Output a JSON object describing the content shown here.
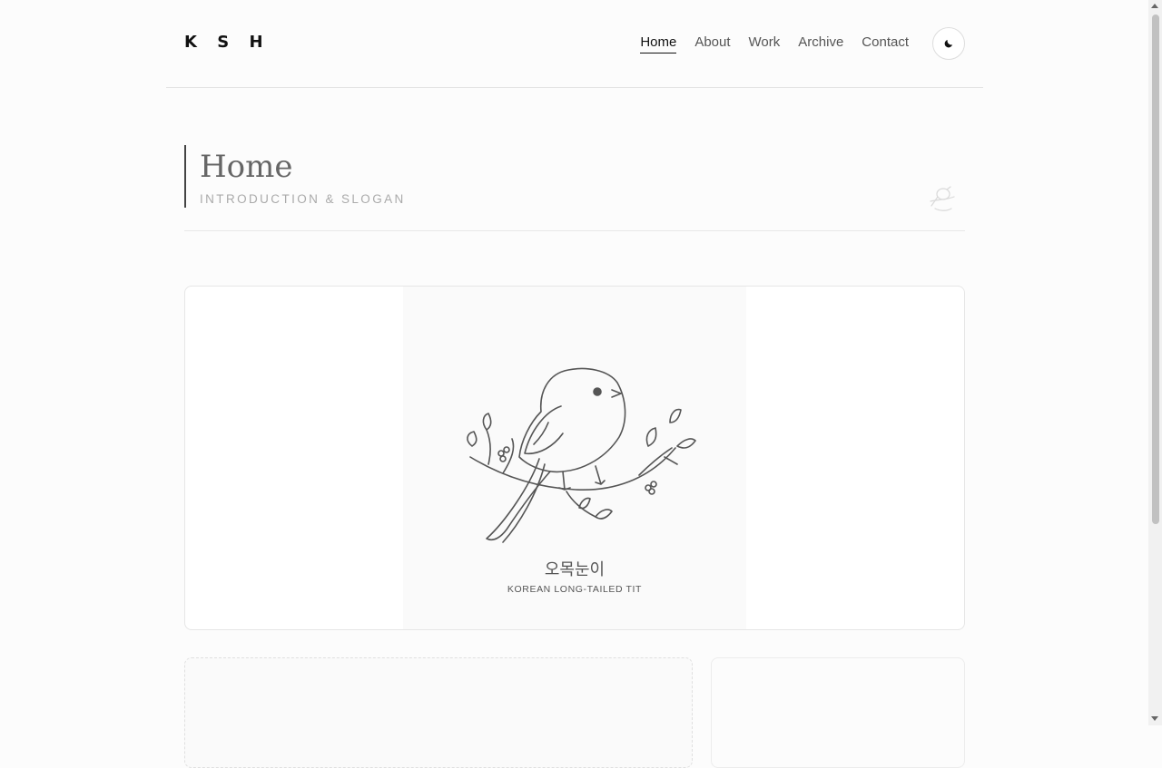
{
  "header": {
    "brand": "K S H",
    "nav": [
      {
        "label": "Home",
        "active": true
      },
      {
        "label": "About",
        "active": false
      },
      {
        "label": "Work",
        "active": false
      },
      {
        "label": "Archive",
        "active": false
      },
      {
        "label": "Contact",
        "active": false
      }
    ],
    "theme_toggle_icon": "moon-icon"
  },
  "page_head": {
    "title": "Home",
    "subtitle": "INTRODUCTION & SLOGAN",
    "emblem_icon": "bird-emblem-icon"
  },
  "hero": {
    "illustration_icon": "bird-on-branch-illustration",
    "name_ko": "오목눈이",
    "name_en": "KOREAN LONG-TAILED TIT"
  },
  "colors": {
    "background": "#fcfcfc",
    "text": "#111111",
    "muted": "#aaaaaa",
    "border": "#e6e6e6"
  }
}
